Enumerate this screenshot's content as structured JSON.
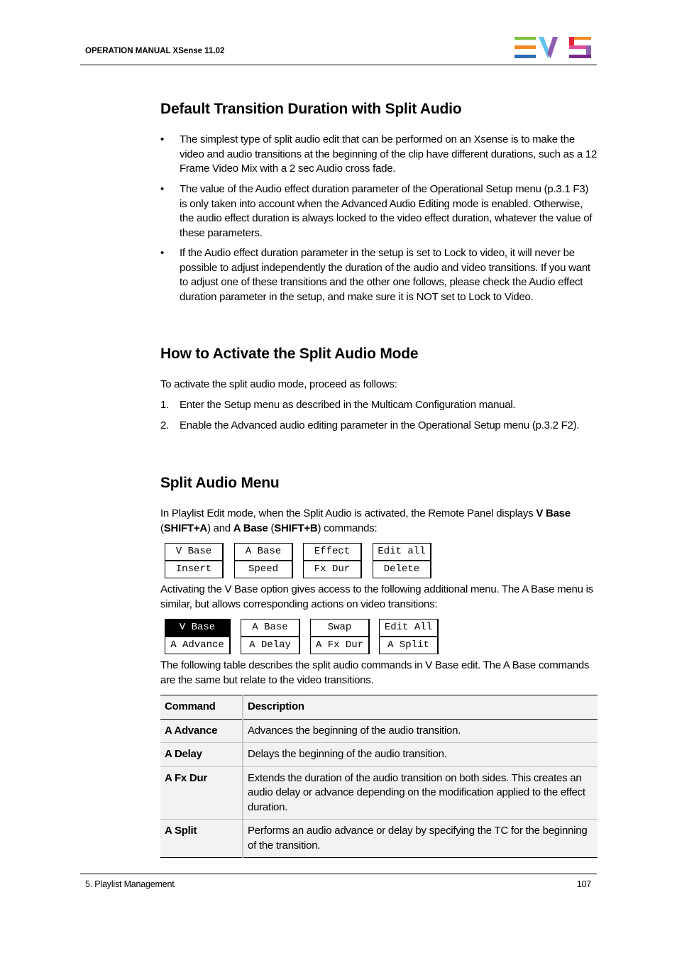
{
  "header": {
    "title": "OPERATION MANUAL  XSense 11.02",
    "logo_name": "EVS",
    "logo_colors": {
      "green": "#7dc242",
      "orange": "#f08a24",
      "blue": "#2f6db5",
      "light_blue": "#5fc3ee",
      "purple": "#8d5fb0",
      "red": "#e5253a",
      "pink": "#e04f9a",
      "dark_purple": "#7b2a8c"
    }
  },
  "sections": {
    "default_transition": {
      "title": "Default Transition Duration with Split Audio",
      "bullets": [
        "The simplest type of split audio edit that can be performed on an Xsense is to make the video and audio transitions at the beginning of the clip have different durations, such as a 12 Frame Video Mix with a 2 sec Audio cross fade.",
        "The value of the Audio effect duration parameter of the Operational Setup menu (p.3.1 F3) is only taken into account when the Advanced Audio Editing mode is enabled. Otherwise, the audio effect duration is always locked to the video effect duration, whatever the value of these parameters.",
        "If the Audio effect duration parameter in the setup is set to Lock to video, it will never be possible to adjust independently the duration of the audio and video transitions. If you want to adjust one of these transitions and the other one follows, please check the Audio effect duration parameter in the setup, and make sure it is NOT set to Lock to Video."
      ],
      "bullet_mark": "•"
    },
    "activate": {
      "title": "How to Activate the Split Audio Mode",
      "intro": "To activate the split audio mode, proceed as follows:",
      "steps": [
        {
          "num": "1.",
          "text": "Enter the Setup menu as described in the Multicam Configuration manual."
        },
        {
          "num": "2.",
          "text": "Enable the Advanced audio editing parameter in the Operational Setup menu (p.3.2 F2)."
        }
      ]
    },
    "split_menu": {
      "title": "Split Audio Menu",
      "intro": {
        "p1": "In Playlist Edit mode, when the Split Audio is activated, the Remote Panel displays ",
        "b1": "V Base",
        "p2": " (",
        "b2": "SHIFT+A",
        "p3": ") and ",
        "b3": "A Base",
        "p4": " (",
        "b4": "SHIFT+B",
        "p5": ") commands:"
      },
      "menu1": [
        {
          "top": "V Base",
          "bottom": "Insert"
        },
        {
          "top": "A Base",
          "bottom": "Speed"
        },
        {
          "top": "Effect",
          "bottom": "Fx Dur"
        },
        {
          "top": "Edit all",
          "bottom": "Delete"
        }
      ],
      "para2": "Activating the V Base option gives access to the following additional menu. The A Base menu is similar, but allows corresponding actions on video transitions:",
      "menu2": [
        {
          "top": "V Base",
          "bottom": "A Advance",
          "highlighted": true
        },
        {
          "top": "A Base",
          "bottom": "A Delay"
        },
        {
          "top": "Swap",
          "bottom": "A Fx Dur"
        },
        {
          "top": "Edit All",
          "bottom": "A Split"
        }
      ],
      "para3": "The following table describes the split audio commands in V Base edit. The A Base commands are the same but relate to the video transitions.",
      "table": {
        "headers": [
          "Command",
          "Description"
        ],
        "rows": [
          {
            "command": "A Advance",
            "description": "Advances the beginning of the audio transition."
          },
          {
            "command": "A Delay",
            "description": "Delays the beginning of the audio transition."
          },
          {
            "command": "A Fx Dur",
            "description": "Extends the duration of the audio transition on both sides. This creates an audio delay or advance depending on the modification applied to the effect duration."
          },
          {
            "command": "A Split",
            "description": "Performs an audio advance or delay by specifying the TC for the beginning of the transition."
          }
        ]
      }
    }
  },
  "footer": {
    "chapter": "5. Playlist Management",
    "page_number": "107"
  }
}
